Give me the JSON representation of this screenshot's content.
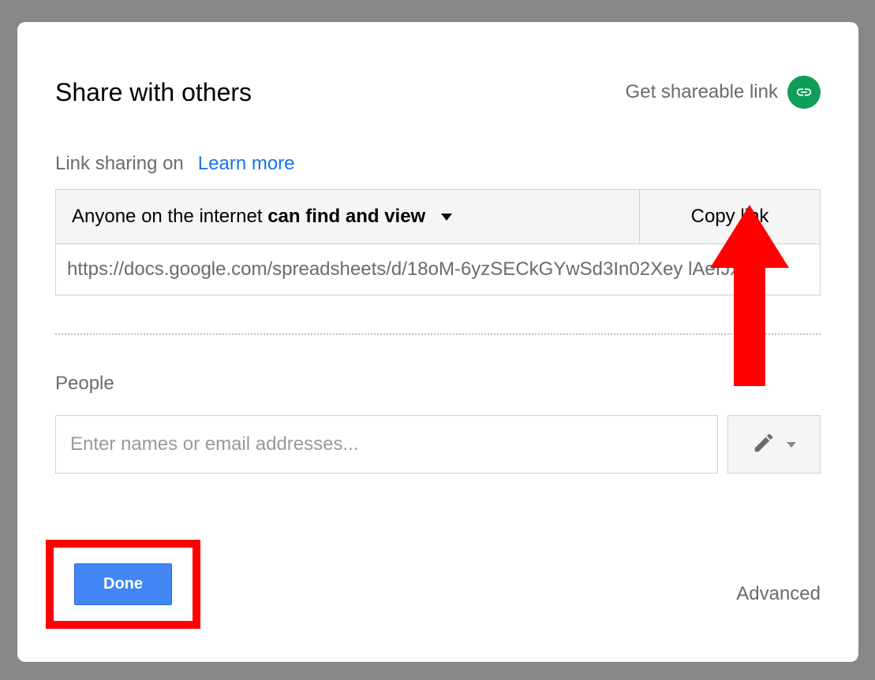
{
  "header": {
    "title": "Share with others",
    "get_shareable_link": "Get shareable link"
  },
  "link_sharing": {
    "status_label": "Link sharing on",
    "learn_more": "Learn more",
    "visibility_prefix": "Anyone on the internet ",
    "visibility_bold": "can find and view",
    "copy_link_label": "Copy link",
    "url": "https://docs.google.com/spreadsheets/d/18oM-6yzSECkGYwSd3In02Xey    lAefJxl"
  },
  "people": {
    "label": "People",
    "placeholder": "Enter names or email addresses..."
  },
  "footer": {
    "done_label": "Done",
    "advanced_label": "Advanced"
  },
  "icons": {
    "link": "link-icon",
    "pencil": "pencil-icon"
  }
}
